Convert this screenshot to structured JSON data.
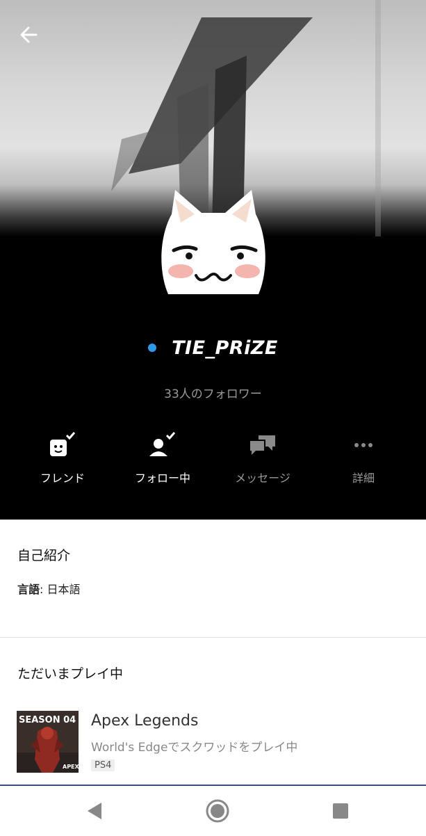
{
  "header": {
    "back_icon": "arrow-left-icon"
  },
  "profile": {
    "username": "TIE_PRiZE",
    "online_color": "#2f9be8",
    "followers_text": "33人のフォロワー"
  },
  "actions": [
    {
      "label": "フレンド",
      "icon": "friend-check-icon"
    },
    {
      "label": "フォロー中",
      "icon": "following-check-icon"
    },
    {
      "label": "メッセージ",
      "icon": "message-icon"
    },
    {
      "label": "詳細",
      "icon": "more-icon"
    }
  ],
  "about": {
    "title": "自己紹介",
    "language_label": "言語",
    "language_value": ": 日本語"
  },
  "now_playing": {
    "title": "ただいまプレイ中",
    "game": {
      "thumb_text": "SEASON 04",
      "thumb_logo": "APEX",
      "name": "Apex Legends",
      "status": "World's Edgeでスクワッドをプレイ中",
      "platform": "PS4"
    }
  },
  "navbar": {
    "back": "nav-back-icon",
    "home": "nav-home-icon",
    "recents": "nav-recents-icon"
  }
}
